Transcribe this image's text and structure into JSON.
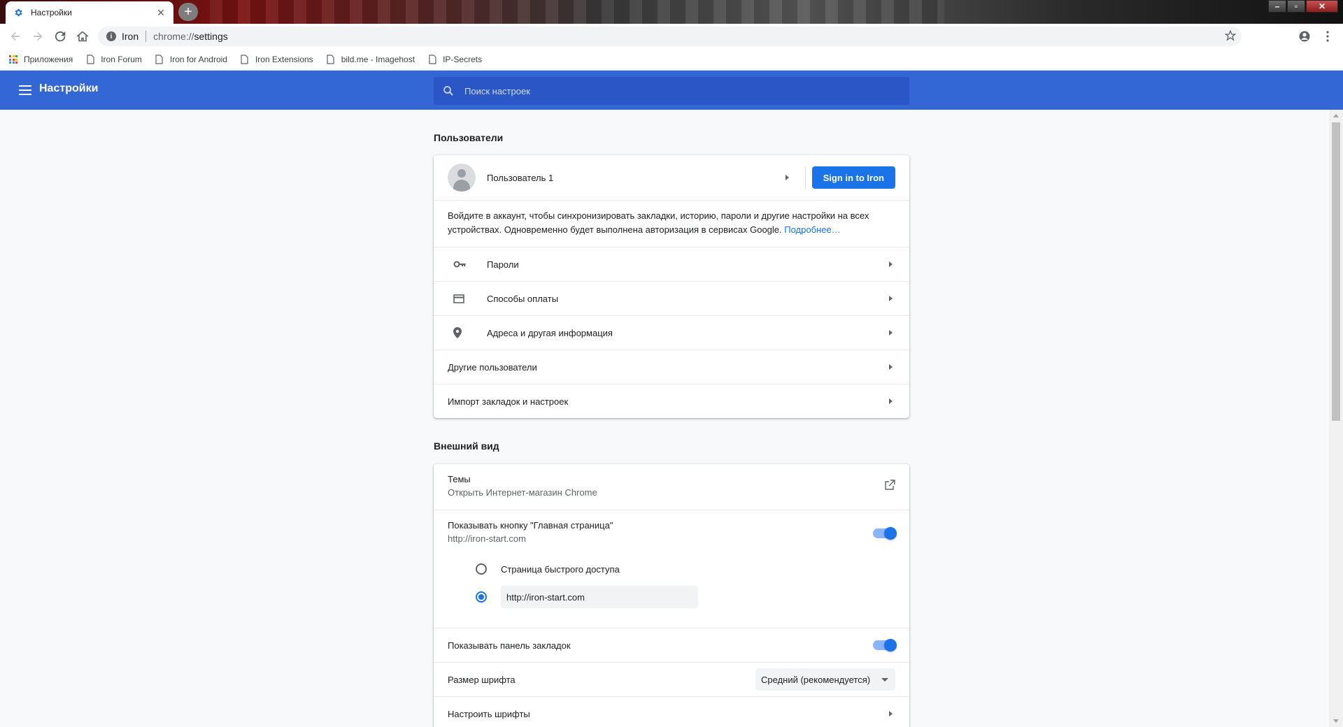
{
  "tab": {
    "title": "Настройки",
    "icon": "gear-icon"
  },
  "toolbar": {
    "back_icon": "arrow-left-icon",
    "forward_icon": "arrow-right-icon",
    "reload_icon": "reload-icon",
    "home_icon": "home-icon"
  },
  "omnibox": {
    "origin": "Iron",
    "scheme": "chrome://",
    "path": "settings"
  },
  "bookmarks": [
    {
      "label": "Приложения",
      "icon": "apps-grid-icon"
    },
    {
      "label": "Iron Forum",
      "icon": "page-icon"
    },
    {
      "label": "Iron for Android",
      "icon": "page-icon"
    },
    {
      "label": "Iron Extensions",
      "icon": "page-icon"
    },
    {
      "label": "bild.me - Imagehost",
      "icon": "page-icon"
    },
    {
      "label": "IP-Secrets",
      "icon": "page-icon"
    }
  ],
  "header": {
    "title": "Настройки",
    "search_placeholder": "Поиск настроек"
  },
  "users": {
    "section_title": "Пользователи",
    "profile_name": "Пользователь 1",
    "signin_label": "Sign in to Iron",
    "description": "Войдите в аккаунт, чтобы синхронизировать закладки, историю, пароли и другие настройки на всех устройствах. Одновременно будет выполнена авторизация в сервисах Google.",
    "learn_more": "Подробнее…",
    "items": [
      {
        "label": "Пароли",
        "icon": "key-icon"
      },
      {
        "label": "Способы оплаты",
        "icon": "credit-card-icon"
      },
      {
        "label": "Адреса и другая информация",
        "icon": "location-pin-icon"
      }
    ],
    "other_users": "Другие пользователи",
    "import": "Импорт закладок и настроек"
  },
  "appearance": {
    "section_title": "Внешний вид",
    "themes_label": "Темы",
    "themes_sub": "Открыть Интернет-магазин Chrome",
    "home_button_label": "Показывать кнопку \"Главная страница\"",
    "home_button_sub": "http://iron-start.com",
    "home_button_on": true,
    "radio_ntp": "Страница быстрого доступа",
    "radio_url_value": "http://iron-start.com",
    "bookmarks_bar_label": "Показывать панель закладок",
    "bookmarks_bar_on": true,
    "font_size_label": "Размер шрифта",
    "font_size_value": "Средний (рекомендуется)",
    "customize_fonts": "Настроить шрифты"
  },
  "colors": {
    "accent": "#1a73e8",
    "header": "#3367d6"
  }
}
